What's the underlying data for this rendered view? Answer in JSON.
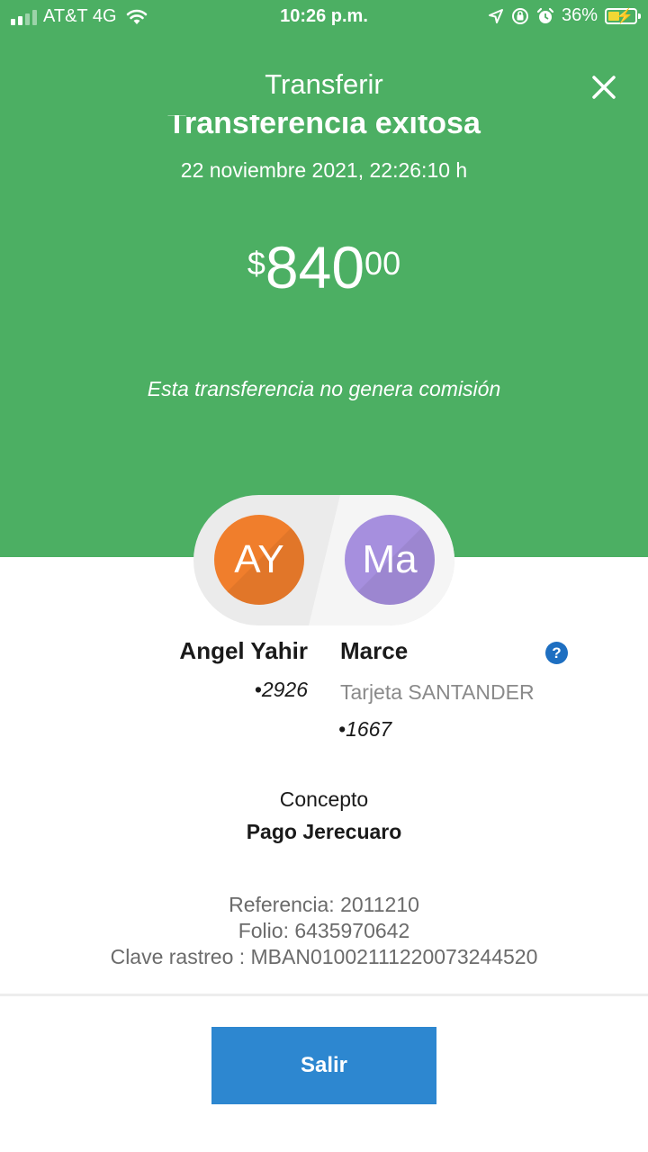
{
  "status_bar": {
    "carrier": "AT&T 4G",
    "time": "10:26 p.m.",
    "battery": "36%"
  },
  "header": {
    "title": "Transferir",
    "close_icon": "close-icon"
  },
  "result": {
    "headline": "Transferencia exitosa",
    "date": "22 noviembre 2021, 22:26:10 h",
    "amount_currency": "$",
    "amount_integer": "840",
    "amount_decimals": "00",
    "fee_note": "Esta transferencia no genera comisión"
  },
  "sender": {
    "initials": "AY",
    "name": "Angel Yahir",
    "account": "2926",
    "color": "#f07e2c"
  },
  "recipient": {
    "initials": "Ma",
    "name": "Marce",
    "bank": "Tarjeta SANTANDER",
    "account": "1667",
    "color": "#a68fde"
  },
  "help_icon": {
    "label": "?"
  },
  "concept": {
    "label": "Concepto",
    "value": "Pago Jerecuaro"
  },
  "reference": {
    "referencia": "Referencia: 2011210",
    "folio": "Folio: 6435970642",
    "clave": "Clave rastreo : MBAN01002111220073244520"
  },
  "footer": {
    "exit_label": "Salir"
  },
  "colors": {
    "header_green": "#4caf63",
    "button_blue": "#2d87d0"
  }
}
